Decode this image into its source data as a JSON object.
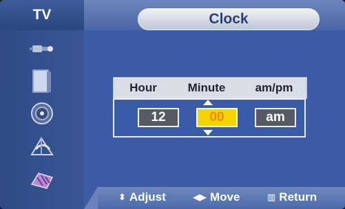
{
  "header": {
    "section_label": "TV",
    "title": "Clock"
  },
  "sidebar": {
    "items": [
      {
        "icon": "input-plug-icon"
      },
      {
        "icon": "picture-screen-icon"
      },
      {
        "icon": "sound-speaker-icon"
      },
      {
        "icon": "antenna-dish-icon"
      },
      {
        "icon": "setup-connector-icon"
      }
    ]
  },
  "clock": {
    "columns": [
      "Hour",
      "Minute",
      "am/pm"
    ],
    "hour": "12",
    "minute": "00",
    "ampm": "am",
    "active_field": "minute"
  },
  "footer": {
    "adjust_label": "Adjust",
    "move_label": "Move",
    "return_label": "Return"
  },
  "colors": {
    "background": "#3c5ca6",
    "highlight": "#f3d300",
    "highlight_text": "#f08c00"
  }
}
